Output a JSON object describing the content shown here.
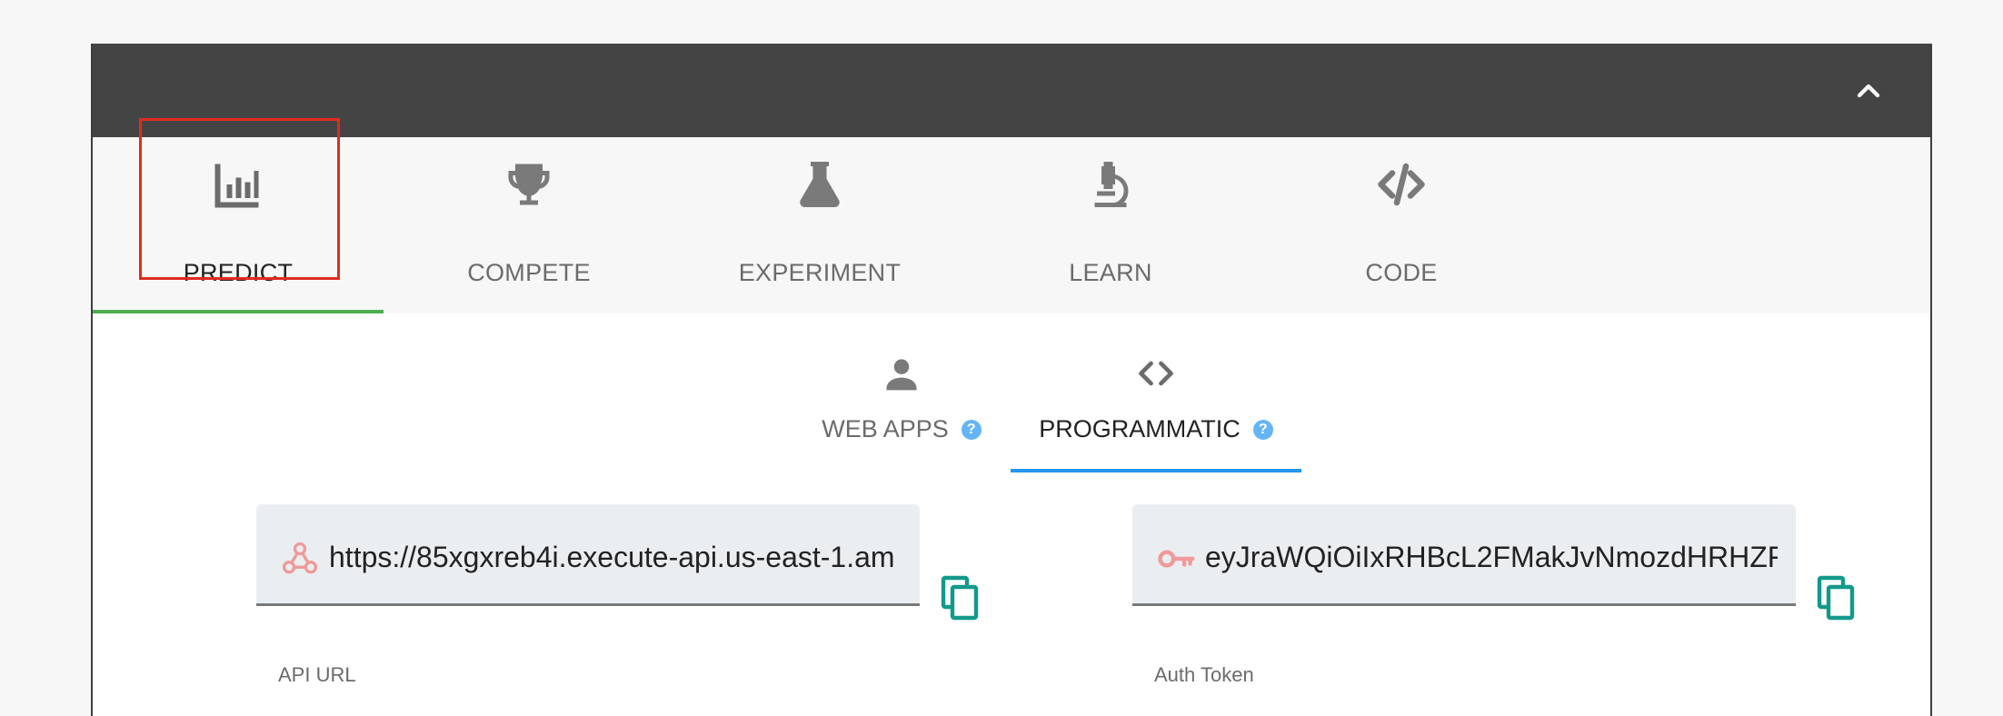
{
  "header": {
    "collapse_icon": "chevron-up-icon"
  },
  "tabs": [
    {
      "label": "PREDICT",
      "icon": "bar-chart-icon",
      "active": true
    },
    {
      "label": "COMPETE",
      "icon": "trophy-icon",
      "active": false
    },
    {
      "label": "EXPERIMENT",
      "icon": "flask-icon",
      "active": false
    },
    {
      "label": "LEARN",
      "icon": "microscope-icon",
      "active": false
    },
    {
      "label": "CODE",
      "icon": "code-icon",
      "active": false
    }
  ],
  "subtabs": [
    {
      "label": "WEB APPS",
      "icon": "person-icon",
      "help": "?",
      "active": false
    },
    {
      "label": "PROGRAMMATIC",
      "icon": "angle-brackets-icon",
      "help": "?",
      "active": true
    }
  ],
  "fields": {
    "api_url": {
      "value": "https://85xgxreb4i.execute-api.us-east-1.am",
      "label": "API URL",
      "icon": "webhook-icon"
    },
    "auth_token": {
      "value": "eyJraWQiOiIxRHBcL2FMakJvNmozdHRHZF",
      "label": "Auth Token",
      "icon": "key-icon"
    }
  },
  "colors": {
    "header_bg": "#444444",
    "active_tab_underline": "#4caf50",
    "active_subtab_underline": "#2196f3",
    "copy_icon": "#13998a",
    "field_icon": "#ef9a9a",
    "highlight_box": "#e02b20"
  }
}
